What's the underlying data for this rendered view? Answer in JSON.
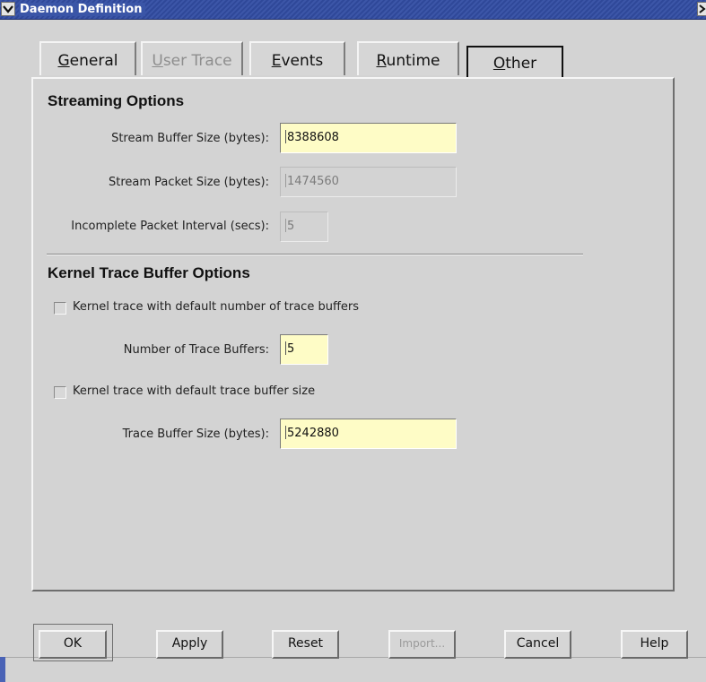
{
  "window": {
    "title": "Daemon Definition"
  },
  "tabs": [
    {
      "label": "General",
      "mnemonic": "G",
      "rest": "eneral",
      "state": "normal"
    },
    {
      "label": "User Trace",
      "mnemonic": "U",
      "rest": "ser Trace",
      "state": "disabled"
    },
    {
      "label": "Events",
      "mnemonic": "E",
      "rest": "vents",
      "state": "normal"
    },
    {
      "label": "Runtime",
      "mnemonic": "R",
      "rest": "untime",
      "state": "normal"
    },
    {
      "label": "Other",
      "mnemonic": "O",
      "rest": "ther",
      "state": "active"
    }
  ],
  "streaming": {
    "title": "Streaming Options",
    "buffer_size_label": "Stream Buffer Size (bytes):",
    "buffer_size_value": "8388608",
    "packet_size_label": "Stream Packet Size (bytes):",
    "packet_size_value": "1474560",
    "interval_label": "Incomplete Packet Interval (secs):",
    "interval_value": "5"
  },
  "kernel": {
    "title": "Kernel Trace Buffer Options",
    "default_number_label": "Kernel trace with default number of trace buffers",
    "default_number_checked": false,
    "num_buffers_label": "Number of Trace Buffers:",
    "num_buffers_value": "5",
    "default_size_label": "Kernel trace with default trace buffer size",
    "default_size_checked": false,
    "buffer_size_label": "Trace Buffer Size (bytes):",
    "buffer_size_value": "5242880"
  },
  "buttons": {
    "ok": "OK",
    "apply": "Apply",
    "reset": "Reset",
    "import": "Import...",
    "cancel": "Cancel",
    "help": "Help"
  },
  "colors": {
    "titlebar": "#3c56a8",
    "field_bg": "#fefcc6",
    "window_bg": "#d3d3d3"
  }
}
